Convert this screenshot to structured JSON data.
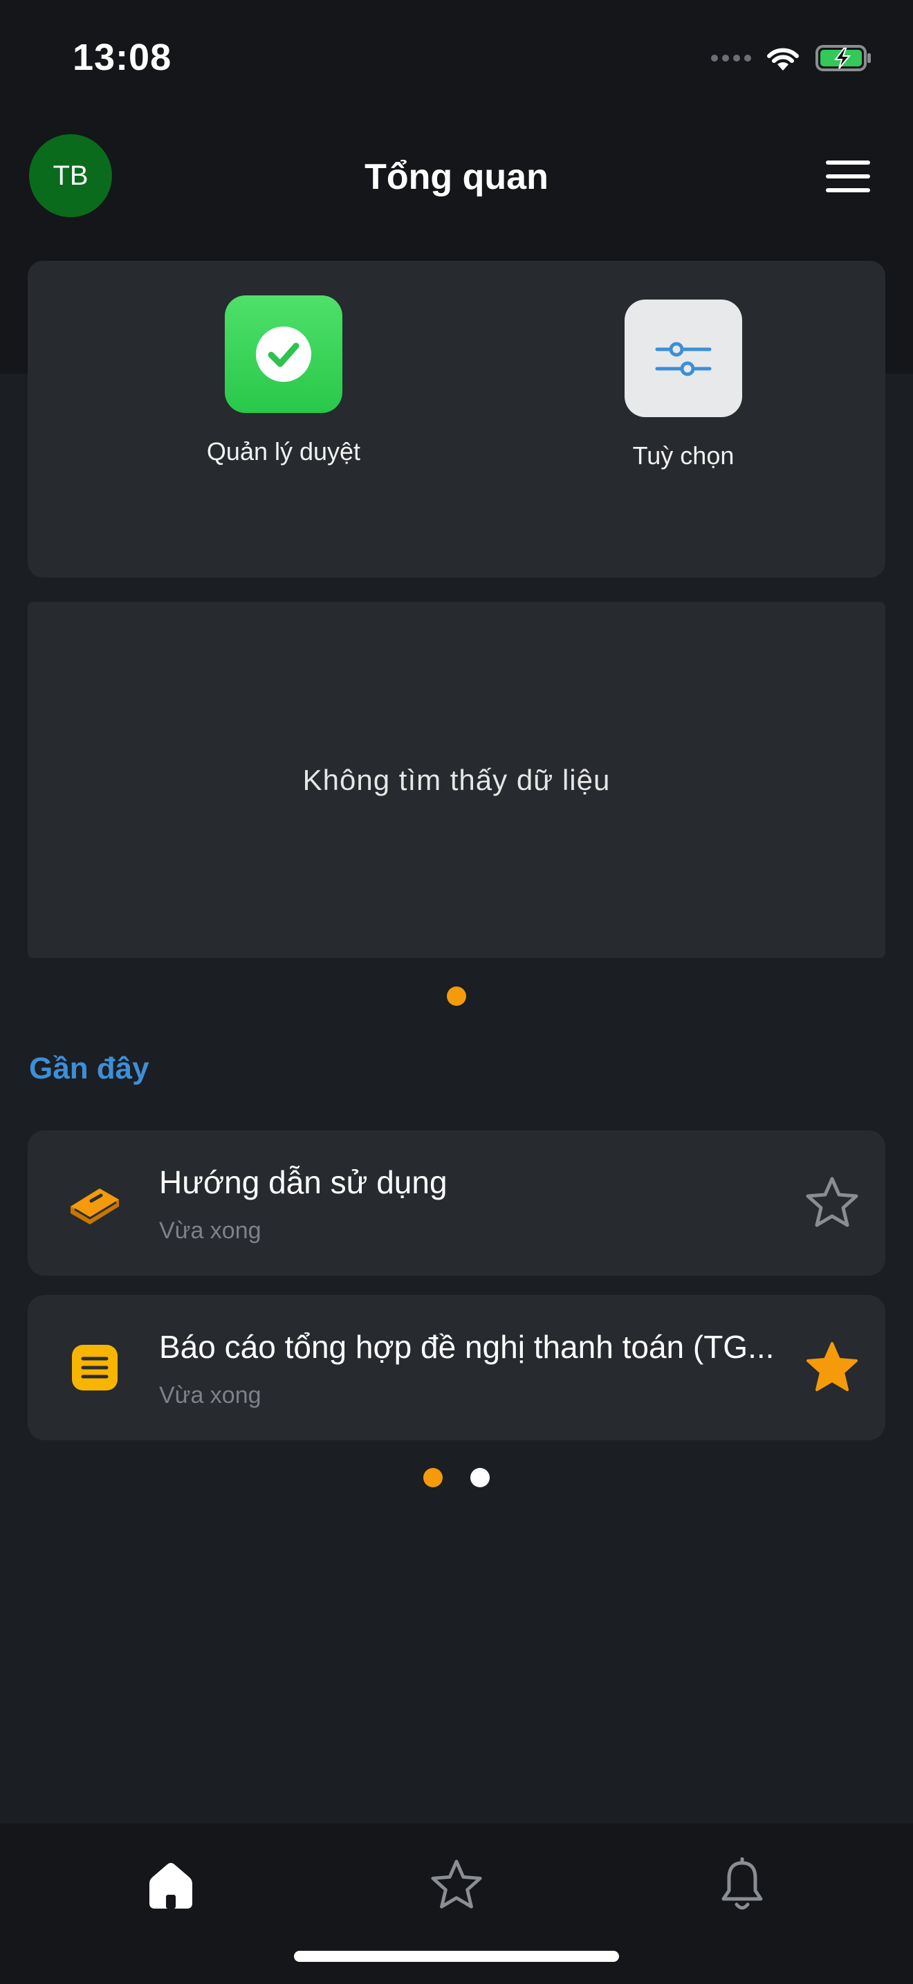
{
  "status_bar": {
    "time": "13:08"
  },
  "header": {
    "avatar_initials": "TB",
    "title": "Tổng quan"
  },
  "quick_actions": [
    {
      "label": "Quản lý duyệt",
      "icon": "check-circle-icon",
      "color": "#34d158"
    },
    {
      "label": "Tuỳ chọn",
      "icon": "sliders-icon",
      "color": "#3b8fd8"
    }
  ],
  "empty_state": {
    "text": "Không tìm thấy dữ liệu"
  },
  "recent": {
    "title": "Gần đây",
    "items": [
      {
        "title": "Hướng dẫn sử dụng",
        "subtitle": "Vừa xong",
        "icon": "book-icon",
        "favorite": false
      },
      {
        "title": "Báo cáo tổng hợp đề nghị thanh toán (TG...",
        "subtitle": "Vừa xong",
        "icon": "document-list-icon",
        "favorite": true
      }
    ]
  },
  "tabs": [
    {
      "name": "home",
      "icon": "home-icon",
      "active": true
    },
    {
      "name": "favorites",
      "icon": "star-icon",
      "active": false
    },
    {
      "name": "notifications",
      "icon": "bell-icon",
      "active": false
    }
  ],
  "colors": {
    "accent": "#f59a0a",
    "link": "#3d8fd8",
    "background": "#1b1e22",
    "card": "#272a2f",
    "avatar": "#0a6b1c"
  }
}
